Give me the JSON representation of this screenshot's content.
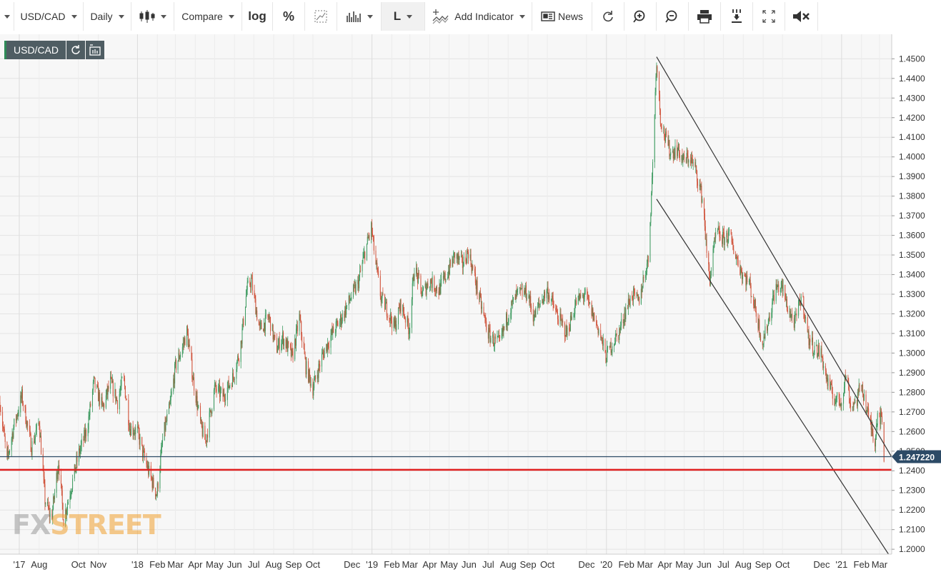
{
  "toolbar": {
    "symbol": "USD/CAD",
    "interval": "Daily",
    "compare": "Compare",
    "log": "log",
    "percent": "%",
    "line_type": "L",
    "add_indicator": "Add Indicator",
    "news": "News"
  },
  "symbol_box": {
    "label": "USD/CAD"
  },
  "watermark": {
    "fx": "FX",
    "street": "STREET"
  },
  "colors": {
    "up": "#3c9a5f",
    "down": "#d0523a",
    "level": "#e02020",
    "price": "#2c4a66",
    "channel": "#333333"
  },
  "chart_data": {
    "type": "candlestick",
    "title": "",
    "symbol": "USD/CAD",
    "interval": "Daily",
    "ylim": [
      1.1975,
      1.4625
    ],
    "y_ticks": [
      "1.2000",
      "1.2100",
      "1.2200",
      "1.2300",
      "1.2400",
      "1.2500",
      "1.2600",
      "1.2700",
      "1.2800",
      "1.2900",
      "1.3000",
      "1.3100",
      "1.3200",
      "1.3300",
      "1.3400",
      "1.3500",
      "1.3600",
      "1.3700",
      "1.3800",
      "1.3900",
      "1.4000",
      "1.4100",
      "1.4200",
      "1.4300",
      "1.4400",
      "1.4500"
    ],
    "x_ticks": [
      "'17",
      "Aug",
      "Oct",
      "Nov",
      "'18",
      "Feb",
      "Mar",
      "Apr",
      "May",
      "Jun",
      "Jul",
      "Aug",
      "Sep",
      "Oct",
      "Dec",
      "'19",
      "Feb",
      "Mar",
      "Apr",
      "May",
      "Jun",
      "Jul",
      "Aug",
      "Sep",
      "Oct",
      "Dec",
      "'20",
      "Feb",
      "Mar",
      "Apr",
      "May",
      "Jun",
      "Jul",
      "Aug",
      "Sep",
      "Oct",
      "Dec",
      "'21",
      "Feb",
      "Mar"
    ],
    "x_tick_dates": [
      "2017-07-01",
      "2017-08-01",
      "2017-10-01",
      "2017-11-01",
      "2018-01-01",
      "2018-02-01",
      "2018-03-01",
      "2018-04-01",
      "2018-05-01",
      "2018-06-01",
      "2018-07-01",
      "2018-08-01",
      "2018-09-01",
      "2018-10-01",
      "2018-12-01",
      "2019-01-01",
      "2019-02-01",
      "2019-03-01",
      "2019-04-01",
      "2019-05-01",
      "2019-06-01",
      "2019-07-01",
      "2019-08-01",
      "2019-09-01",
      "2019-10-01",
      "2019-12-01",
      "2020-01-01",
      "2020-02-01",
      "2020-03-01",
      "2020-04-01",
      "2020-05-01",
      "2020-06-01",
      "2020-07-01",
      "2020-08-01",
      "2020-09-01",
      "2020-10-01",
      "2020-12-01",
      "2021-01-01",
      "2021-02-01",
      "2021-03-01"
    ],
    "x_range": [
      "2017-06-01",
      "2021-03-20"
    ],
    "price_path": [
      [
        "2017-06-01",
        1.275
      ],
      [
        "2017-06-12",
        1.245
      ],
      [
        "2017-06-22",
        1.262
      ],
      [
        "2017-07-05",
        1.278
      ],
      [
        "2017-07-20",
        1.252
      ],
      [
        "2017-08-01",
        1.265
      ],
      [
        "2017-08-10",
        1.225
      ],
      [
        "2017-08-20",
        1.215
      ],
      [
        "2017-08-31",
        1.245
      ],
      [
        "2017-09-08",
        1.215
      ],
      [
        "2017-09-20",
        1.232
      ],
      [
        "2017-10-01",
        1.248
      ],
      [
        "2017-10-15",
        1.262
      ],
      [
        "2017-10-25",
        1.285
      ],
      [
        "2017-11-08",
        1.272
      ],
      [
        "2017-11-20",
        1.285
      ],
      [
        "2017-12-01",
        1.275
      ],
      [
        "2017-12-10",
        1.288
      ],
      [
        "2017-12-20",
        1.262
      ],
      [
        "2018-01-01",
        1.26
      ],
      [
        "2018-01-10",
        1.248
      ],
      [
        "2018-01-20",
        1.238
      ],
      [
        "2018-01-31",
        1.228
      ],
      [
        "2018-02-10",
        1.258
      ],
      [
        "2018-02-20",
        1.272
      ],
      [
        "2018-03-01",
        1.293
      ],
      [
        "2018-03-12",
        1.303
      ],
      [
        "2018-03-19",
        1.311
      ],
      [
        "2018-03-28",
        1.288
      ],
      [
        "2018-04-10",
        1.262
      ],
      [
        "2018-04-17",
        1.255
      ],
      [
        "2018-05-01",
        1.282
      ],
      [
        "2018-05-15",
        1.278
      ],
      [
        "2018-05-30",
        1.288
      ],
      [
        "2018-06-10",
        1.302
      ],
      [
        "2018-06-20",
        1.332
      ],
      [
        "2018-06-27",
        1.337
      ],
      [
        "2018-07-10",
        1.312
      ],
      [
        "2018-07-25",
        1.318
      ],
      [
        "2018-08-05",
        1.302
      ],
      [
        "2018-08-15",
        1.308
      ],
      [
        "2018-08-30",
        1.298
      ],
      [
        "2018-09-10",
        1.318
      ],
      [
        "2018-09-20",
        1.293
      ],
      [
        "2018-10-01",
        1.282
      ],
      [
        "2018-10-15",
        1.298
      ],
      [
        "2018-10-31",
        1.31
      ],
      [
        "2018-11-15",
        1.318
      ],
      [
        "2018-11-30",
        1.329
      ],
      [
        "2018-12-10",
        1.335
      ],
      [
        "2018-12-20",
        1.35
      ],
      [
        "2018-12-31",
        1.364
      ],
      [
        "2019-01-07",
        1.345
      ],
      [
        "2019-01-15",
        1.328
      ],
      [
        "2019-01-25",
        1.322
      ],
      [
        "2019-02-05",
        1.313
      ],
      [
        "2019-02-15",
        1.325
      ],
      [
        "2019-02-28",
        1.312
      ],
      [
        "2019-03-08",
        1.344
      ],
      [
        "2019-03-20",
        1.33
      ],
      [
        "2019-04-01",
        1.337
      ],
      [
        "2019-04-15",
        1.332
      ],
      [
        "2019-04-30",
        1.342
      ],
      [
        "2019-05-10",
        1.35
      ],
      [
        "2019-05-22",
        1.345
      ],
      [
        "2019-05-31",
        1.352
      ],
      [
        "2019-06-10",
        1.338
      ],
      [
        "2019-06-20",
        1.324
      ],
      [
        "2019-07-01",
        1.31
      ],
      [
        "2019-07-10",
        1.306
      ],
      [
        "2019-07-19",
        1.305
      ],
      [
        "2019-08-01",
        1.32
      ],
      [
        "2019-08-15",
        1.33
      ],
      [
        "2019-08-31",
        1.331
      ],
      [
        "2019-09-10",
        1.318
      ],
      [
        "2019-09-20",
        1.326
      ],
      [
        "2019-10-01",
        1.332
      ],
      [
        "2019-10-15",
        1.32
      ],
      [
        "2019-10-31",
        1.31
      ],
      [
        "2019-11-15",
        1.326
      ],
      [
        "2019-11-28",
        1.33
      ],
      [
        "2019-12-10",
        1.32
      ],
      [
        "2019-12-20",
        1.312
      ],
      [
        "2019-12-31",
        1.298
      ],
      [
        "2020-01-10",
        1.305
      ],
      [
        "2020-01-20",
        1.31
      ],
      [
        "2020-01-31",
        1.322
      ],
      [
        "2020-02-10",
        1.33
      ],
      [
        "2020-02-20",
        1.326
      ],
      [
        "2020-02-29",
        1.34
      ],
      [
        "2020-03-06",
        1.348
      ],
      [
        "2020-03-12",
        1.388
      ],
      [
        "2020-03-19",
        1.45
      ],
      [
        "2020-03-25",
        1.42
      ],
      [
        "2020-04-01",
        1.41
      ],
      [
        "2020-04-10",
        1.402
      ],
      [
        "2020-04-20",
        1.404
      ],
      [
        "2020-04-30",
        1.398
      ],
      [
        "2020-05-10",
        1.4
      ],
      [
        "2020-05-20",
        1.392
      ],
      [
        "2020-05-31",
        1.376
      ],
      [
        "2020-06-05",
        1.35
      ],
      [
        "2020-06-10",
        1.338
      ],
      [
        "2020-06-20",
        1.362
      ],
      [
        "2020-06-30",
        1.358
      ],
      [
        "2020-07-10",
        1.36
      ],
      [
        "2020-07-20",
        1.35
      ],
      [
        "2020-07-31",
        1.34
      ],
      [
        "2020-08-10",
        1.336
      ],
      [
        "2020-08-20",
        1.322
      ],
      [
        "2020-08-31",
        1.305
      ],
      [
        "2020-09-10",
        1.318
      ],
      [
        "2020-09-20",
        1.333
      ],
      [
        "2020-09-30",
        1.334
      ],
      [
        "2020-10-10",
        1.322
      ],
      [
        "2020-10-20",
        1.315
      ],
      [
        "2020-10-31",
        1.33
      ],
      [
        "2020-11-10",
        1.308
      ],
      [
        "2020-11-20",
        1.302
      ],
      [
        "2020-11-30",
        1.3
      ],
      [
        "2020-12-10",
        1.285
      ],
      [
        "2020-12-20",
        1.277
      ],
      [
        "2020-12-31",
        1.275
      ],
      [
        "2021-01-08",
        1.29
      ],
      [
        "2021-01-15",
        1.273
      ],
      [
        "2021-01-25",
        1.276
      ],
      [
        "2021-02-01",
        1.285
      ],
      [
        "2021-02-08",
        1.272
      ],
      [
        "2021-02-15",
        1.264
      ],
      [
        "2021-02-22",
        1.255
      ],
      [
        "2021-02-26",
        1.271
      ],
      [
        "2021-03-05",
        1.265
      ],
      [
        "2021-03-08",
        1.247
      ]
    ],
    "horizontal_lines": [
      {
        "name": "support",
        "y": 1.2405,
        "color": "#e02020"
      },
      {
        "name": "last-price",
        "y": 1.2472,
        "color": "#2c4a66"
      }
    ],
    "channel_lines": [
      {
        "name": "channel-upper",
        "from": [
          "2020-03-19",
          1.451
        ],
        "to": [
          "2021-03-20",
          1.247
        ]
      },
      {
        "name": "channel-lower",
        "from": [
          "2020-03-19",
          1.3785
        ],
        "to": [
          "2021-03-15",
          1.1975
        ]
      }
    ],
    "last_price_label": "1.247220",
    "grid": true
  }
}
